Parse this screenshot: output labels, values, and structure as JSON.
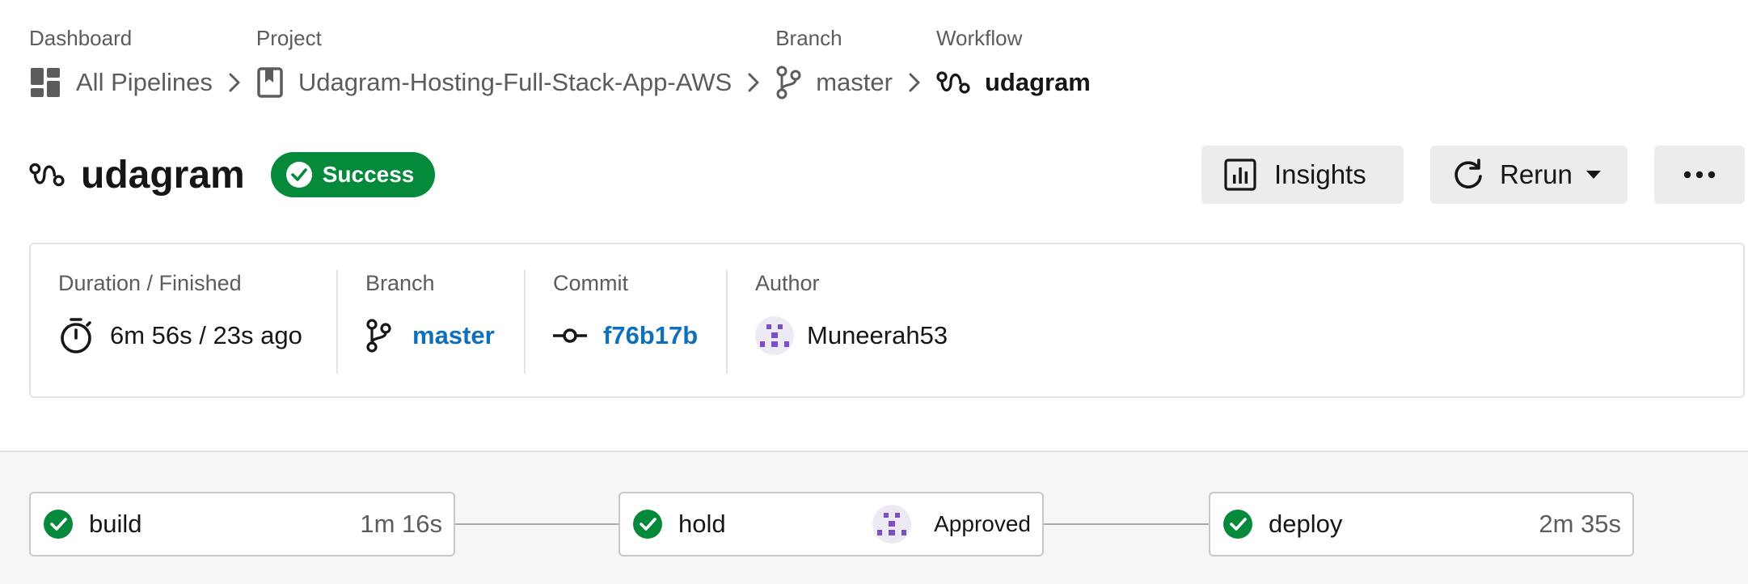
{
  "breadcrumb": {
    "dashboard": {
      "label": "Dashboard",
      "link": "All Pipelines"
    },
    "project": {
      "label": "Project",
      "link": "Udagram-Hosting-Full-Stack-App-AWS"
    },
    "branch": {
      "label": "Branch",
      "link": "master"
    },
    "workflow": {
      "label": "Workflow",
      "link": "udagram"
    }
  },
  "header": {
    "title": "udagram",
    "status": "Success",
    "insights_label": "Insights",
    "rerun_label": "Rerun",
    "more_icon": "more-horizontal-icon"
  },
  "details": {
    "duration": {
      "label": "Duration / Finished",
      "value": "6m 56s / 23s ago"
    },
    "branch": {
      "label": "Branch",
      "value": "master"
    },
    "commit": {
      "label": "Commit",
      "value": "f76b17b"
    },
    "author": {
      "label": "Author",
      "value": "Muneerah53"
    }
  },
  "jobs": [
    {
      "name": "build",
      "status": "success",
      "duration": "1m 16s"
    },
    {
      "name": "hold",
      "status": "success",
      "approval": "Approved"
    },
    {
      "name": "deploy",
      "status": "success",
      "duration": "2m 35s"
    }
  ],
  "colors": {
    "success": "#048a3a",
    "link": "#0e6fbd",
    "avatar": "#7b4fc9"
  }
}
